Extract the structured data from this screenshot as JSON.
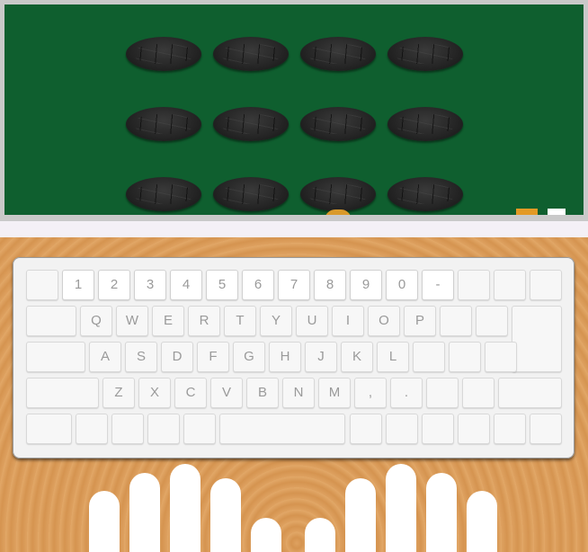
{
  "game": {
    "rocks": [
      {
        "row": 0,
        "col": 0
      },
      {
        "row": 0,
        "col": 1
      },
      {
        "row": 0,
        "col": 2
      },
      {
        "row": 0,
        "col": 3
      },
      {
        "row": 1,
        "col": 0
      },
      {
        "row": 1,
        "col": 1
      },
      {
        "row": 1,
        "col": 2
      },
      {
        "row": 1,
        "col": 3
      },
      {
        "row": 2,
        "col": 0
      },
      {
        "row": 2,
        "col": 1
      },
      {
        "row": 2,
        "col": 2
      },
      {
        "row": 2,
        "col": 3
      }
    ],
    "colors": {
      "board": "#0f5f2f",
      "frame": "#c9c9c9",
      "indicator_a": "#e39a26",
      "indicator_b": "#ffffff",
      "desk": "#d89a55"
    }
  },
  "keyboard": {
    "row1": [
      "",
      "1",
      "2",
      "3",
      "4",
      "5",
      "6",
      "7",
      "8",
      "9",
      "0",
      "-",
      "",
      "",
      ""
    ],
    "row2": [
      "",
      "Q",
      "W",
      "E",
      "R",
      "T",
      "Y",
      "U",
      "I",
      "O",
      "P",
      "",
      ""
    ],
    "row3": [
      "",
      "A",
      "S",
      "D",
      "F",
      "G",
      "H",
      "J",
      "K",
      "L",
      "",
      "",
      ""
    ],
    "row4": [
      "",
      "Z",
      "X",
      "C",
      "V",
      "B",
      "N",
      "M",
      ",",
      ".",
      "",
      ""
    ],
    "row5": [
      "",
      "",
      "",
      "",
      "",
      "",
      "",
      "",
      "",
      "",
      "",
      ""
    ]
  }
}
